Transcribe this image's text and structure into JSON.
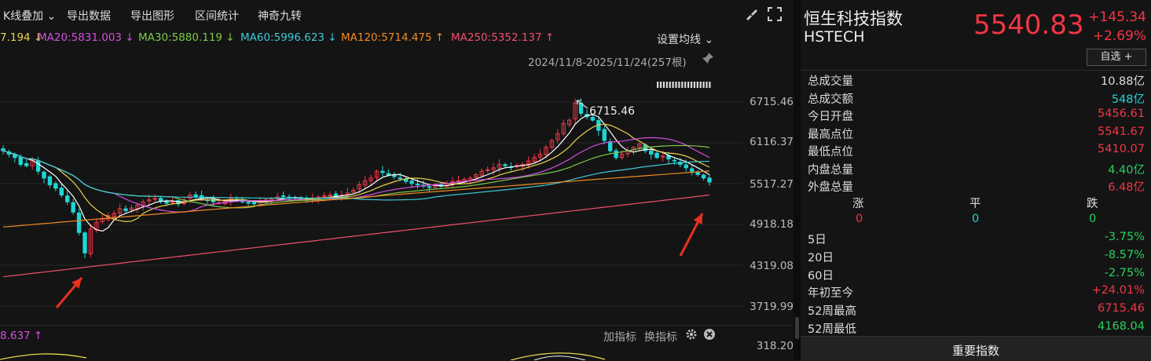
{
  "toolbar": {
    "kline_overlay": "K线叠加",
    "export_data": "导出数据",
    "export_chart": "导出图形",
    "range_stats": "区间统计",
    "magic_nine": "神奇九转"
  },
  "ma_legend": [
    {
      "text": "7.194",
      "arrow": "↓",
      "color": "#e8d44d"
    },
    {
      "text": "MA20:5831.003",
      "arrow": "↓",
      "color": "#d24fe0"
    },
    {
      "text": "MA30:5880.119",
      "arrow": "↓",
      "color": "#7cc94a"
    },
    {
      "text": "MA60:5996.623",
      "arrow": "↓",
      "color": "#3ec8d6"
    },
    {
      "text": "MA120:5714.475",
      "arrow": "↑",
      "color": "#f08a24"
    },
    {
      "text": "MA250:5352.137",
      "arrow": "↑",
      "color": "#f0506e"
    }
  ],
  "set_ma_label": "设置均线",
  "date_range": "2024/11/8-2025/11/24(257根)",
  "peak_label": "6715.46",
  "yaxis_labels": [
    "6715.46",
    "6116.37",
    "5517.27",
    "4918.18",
    "4319.08",
    "3719.99"
  ],
  "sub_panel": {
    "value": "8.637",
    "arrow": "↑",
    "add_indicator": "加指标",
    "switch_indicator": "换指标",
    "axis_label": "318.20"
  },
  "index": {
    "name": "恒生科技指数",
    "code": "HSTECH",
    "price": "5540.83",
    "change": "+145.34",
    "change_pct": "+2.69%",
    "fav_label": "自选 +"
  },
  "stats": [
    {
      "label": "总成交量",
      "value": "10.88亿",
      "color": "#dddddd"
    },
    {
      "label": "总成交额",
      "value": "548亿",
      "color": "#1fd6d6"
    },
    {
      "label": "今日开盘",
      "value": "5456.61",
      "color": "#f23645"
    },
    {
      "label": "最高点位",
      "value": "5541.67",
      "color": "#f23645"
    },
    {
      "label": "最低点位",
      "value": "5410.07",
      "color": "#f23645"
    },
    {
      "label": "内盘总量",
      "value": "4.40亿",
      "color": "#29d15e"
    },
    {
      "label": "外盘总量",
      "value": "6.48亿",
      "color": "#f23645"
    }
  ],
  "advance_decline": {
    "headers": [
      "涨",
      "平",
      "跌"
    ],
    "values": [
      "0",
      "0",
      "0"
    ]
  },
  "performance": [
    {
      "label": "5日",
      "value": "-3.75%",
      "color": "#29d15e"
    },
    {
      "label": "20日",
      "value": "-8.57%",
      "color": "#29d15e"
    },
    {
      "label": "60日",
      "value": "-2.75%",
      "color": "#29d15e"
    },
    {
      "label": "年初至今",
      "value": "+24.01%",
      "color": "#f23645"
    },
    {
      "label": "52周最高",
      "value": "6715.46",
      "color": "#f23645"
    },
    {
      "label": "52周最低",
      "value": "4168.04",
      "color": "#29d15e"
    }
  ],
  "bottom_tab": "重要指数",
  "chart_data": {
    "type": "candlestick",
    "title": "",
    "ylim": [
      3450,
      6950
    ],
    "yticks": [
      6715.46,
      6116.37,
      5517.27,
      4918.18,
      4319.08,
      3719.99
    ],
    "close": [
      6000,
      5950,
      5900,
      5800,
      5780,
      5870,
      5700,
      5600,
      5500,
      5450,
      5350,
      5250,
      5100,
      4800,
      4500,
      4850,
      4950,
      5000,
      5050,
      5080,
      5150,
      5120,
      5160,
      5200,
      5250,
      5280,
      5300,
      5260,
      5230,
      5250,
      5220,
      5280,
      5350,
      5330,
      5300,
      5280,
      5250,
      5240,
      5260,
      5300,
      5280,
      5250,
      5230,
      5220,
      5260,
      5280,
      5300,
      5320,
      5330,
      5300,
      5310,
      5290,
      5280,
      5300,
      5320,
      5340,
      5350,
      5330,
      5350,
      5380,
      5420,
      5500,
      5560,
      5600,
      5700,
      5680,
      5650,
      5620,
      5600,
      5550,
      5520,
      5500,
      5480,
      5460,
      5500,
      5480,
      5520,
      5550,
      5560,
      5580,
      5600,
      5650,
      5700,
      5720,
      5750,
      5800,
      5780,
      5760,
      5780,
      5800,
      5850,
      5900,
      5950,
      6050,
      6150,
      6250,
      6400,
      6450,
      6700,
      6550,
      6500,
      6450,
      6300,
      6150,
      6000,
      5900,
      5950,
      6000,
      6050,
      6100,
      6000,
      5950,
      5900,
      5920,
      5880,
      5850,
      5800,
      5750,
      5700,
      5650,
      5600,
      5540.83
    ],
    "annotations": [
      {
        "label": "6715.46",
        "value": 6715.46
      }
    ],
    "ma_series": [
      {
        "name": "MA5",
        "color": "#ffffff"
      },
      {
        "name": "MA10",
        "color": "#e8d44d"
      },
      {
        "name": "MA20",
        "color": "#d24fe0"
      },
      {
        "name": "MA30",
        "color": "#7cc94a"
      },
      {
        "name": "MA60",
        "color": "#3ec8d6"
      },
      {
        "name": "MA120",
        "color": "#f08a24"
      },
      {
        "name": "MA250",
        "color": "#f0506e"
      }
    ]
  }
}
